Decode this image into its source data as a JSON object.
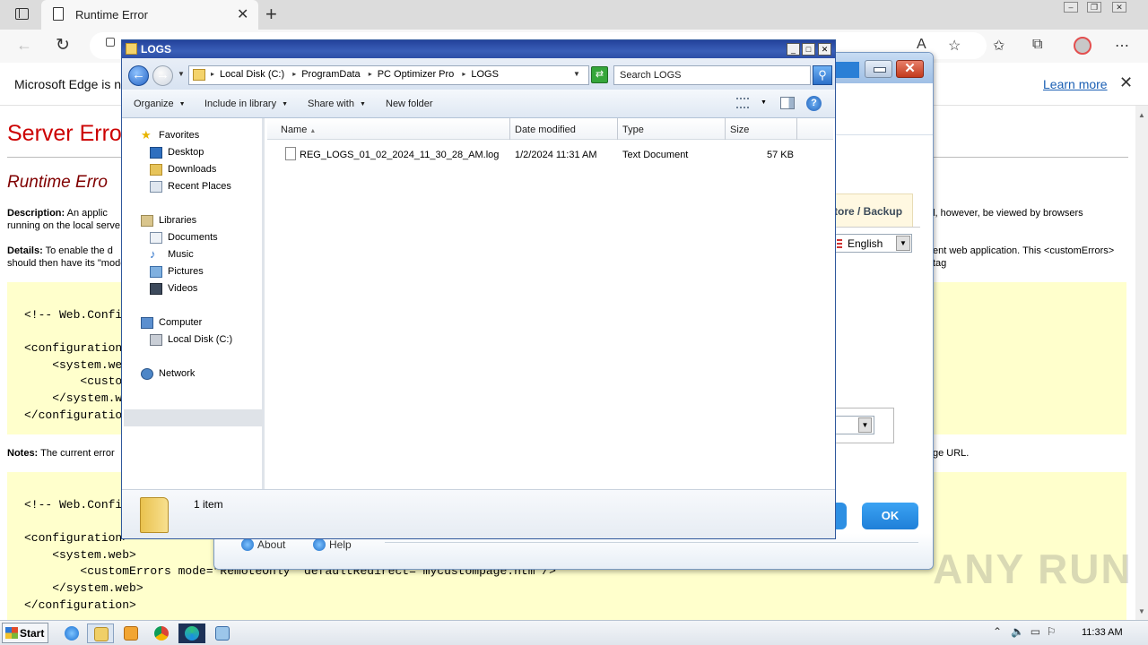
{
  "browser": {
    "tab_title": "Runtime Error",
    "infobar_message": "Microsoft Edge is no",
    "infobar_link": "Learn more"
  },
  "error_page": {
    "h1": "Server Erro",
    "h2": "Runtime Erro",
    "description_label": "Description:",
    "description_text_1": "An applic",
    "description_text_2": "running on the local serve",
    "description_text_right": "ld, however, be viewed by browsers",
    "details_label": "Details:",
    "details_text_1": "To enable the d",
    "details_text_2": "should then have its \"mode",
    "details_text_right": "ent web application. This <customErrors> tag",
    "code1": [
      "<!-- Web.Confi",
      "",
      "<configuration",
      "    <system.web",
      "        <custo",
      "    </system.we",
      "</configuratio"
    ],
    "notes_label": "Notes:",
    "notes_text": "The current error",
    "notes_text_right": "ge URL.",
    "code2": [
      "<!-- Web.Config",
      "",
      "<configuration>",
      "    <system.web>",
      "        <customErrors mode=\"RemoteOnly\" defaultRedirect=\"mycustompage.htm\"/>",
      "    </system.web>",
      "</configuration>"
    ]
  },
  "pc_optimizer": {
    "restore_backup": "tore / Backup",
    "language": "English",
    "ok": "OK",
    "about": "About",
    "help": "Help"
  },
  "explorer": {
    "title": "LOGS",
    "path": [
      "Local Disk (C:)",
      "ProgramData",
      "PC Optimizer Pro",
      "LOGS"
    ],
    "search_placeholder": "Search LOGS",
    "commands": {
      "organize": "Organize",
      "include_in_library": "Include in library",
      "share_with": "Share with",
      "new_folder": "New folder"
    },
    "nav": {
      "favorites": "Favorites",
      "desktop": "Desktop",
      "downloads": "Downloads",
      "recent_places": "Recent Places",
      "libraries": "Libraries",
      "documents": "Documents",
      "music": "Music",
      "pictures": "Pictures",
      "videos": "Videos",
      "computer": "Computer",
      "local_disk": "Local Disk (C:)",
      "network": "Network"
    },
    "columns": {
      "name": "Name",
      "date_modified": "Date modified",
      "type": "Type",
      "size": "Size"
    },
    "files": [
      {
        "name": "REG_LOGS_01_02_2024_11_30_28_AM.log",
        "date_modified": "1/2/2024 11:31 AM",
        "type": "Text Document",
        "size": "57 KB"
      }
    ],
    "status": "1 item"
  },
  "taskbar": {
    "start": "Start",
    "clock": "11:33 AM"
  },
  "watermark": "ANY RUN",
  "colors": {
    "error_red": "#cc0000",
    "code_bg": "#ffffcc",
    "explorer_title": "#2d4fa6"
  }
}
